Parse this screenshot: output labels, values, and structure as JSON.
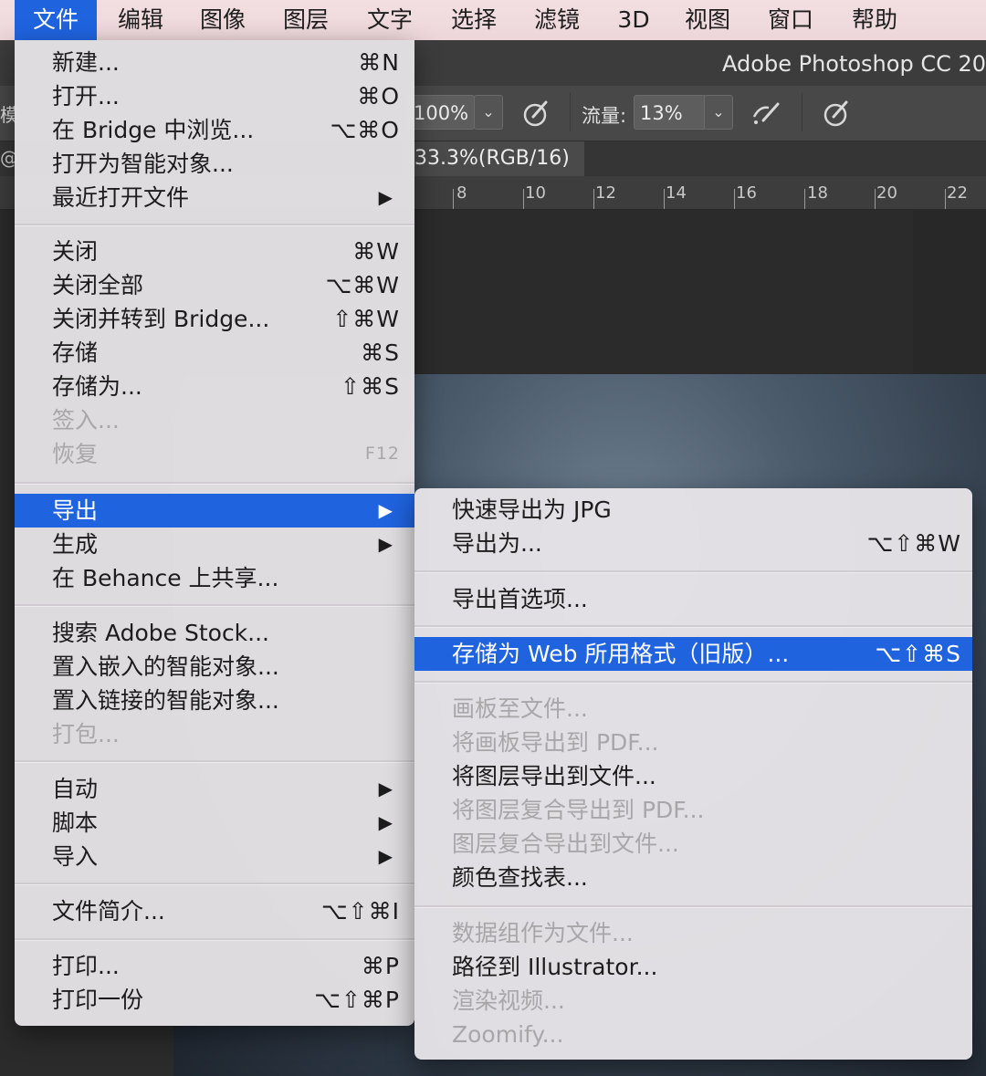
{
  "menubar": {
    "items": [
      "文件",
      "编辑",
      "图像",
      "图层",
      "文字",
      "选择",
      "滤镜",
      "3D",
      "视图",
      "窗口",
      "帮助"
    ],
    "active_index": 0
  },
  "ps": {
    "title": "Adobe Photoshop CC 20",
    "zoom_fragment": "100%",
    "flow_label": "流量:",
    "flow_value": "13%",
    "doc_tab": "33.3%(RGB/16)",
    "left_edge_char": "模",
    "left_edge_at": "@",
    "ruler_numbers": [
      "8",
      "10",
      "12",
      "14",
      "16",
      "18",
      "20",
      "22"
    ]
  },
  "file_menu": {
    "groups": [
      [
        {
          "label": "新建...",
          "shortcut": "⌘N"
        },
        {
          "label": "打开...",
          "shortcut": "⌘O"
        },
        {
          "label": "在 Bridge 中浏览...",
          "shortcut": "⌥⌘O"
        },
        {
          "label": "打开为智能对象...",
          "shortcut": ""
        },
        {
          "label": "最近打开文件",
          "submenu": true
        }
      ],
      [
        {
          "label": "关闭",
          "shortcut": "⌘W"
        },
        {
          "label": "关闭全部",
          "shortcut": "⌥⌘W"
        },
        {
          "label": "关闭并转到 Bridge...",
          "shortcut": "⇧⌘W"
        },
        {
          "label": "存储",
          "shortcut": "⌘S"
        },
        {
          "label": "存储为...",
          "shortcut": "⇧⌘S"
        },
        {
          "label": "签入...",
          "disabled": true
        },
        {
          "label": "恢复",
          "shortcut": "F12",
          "disabled": true
        }
      ],
      [
        {
          "label": "导出",
          "submenu": true,
          "highlight": true
        },
        {
          "label": "生成",
          "submenu": true
        },
        {
          "label": "在 Behance 上共享..."
        }
      ],
      [
        {
          "label": "搜索 Adobe Stock..."
        },
        {
          "label": "置入嵌入的智能对象..."
        },
        {
          "label": "置入链接的智能对象..."
        },
        {
          "label": "打包...",
          "disabled": true
        }
      ],
      [
        {
          "label": "自动",
          "submenu": true
        },
        {
          "label": "脚本",
          "submenu": true
        },
        {
          "label": "导入",
          "submenu": true
        }
      ],
      [
        {
          "label": "文件简介...",
          "shortcut": "⌥⇧⌘I"
        }
      ],
      [
        {
          "label": "打印...",
          "shortcut": "⌘P"
        },
        {
          "label": "打印一份",
          "shortcut": "⌥⇧⌘P"
        }
      ]
    ]
  },
  "export_menu": {
    "groups": [
      [
        {
          "label": "快速导出为 JPG"
        },
        {
          "label": "导出为...",
          "shortcut": "⌥⇧⌘W"
        }
      ],
      [
        {
          "label": "导出首选项..."
        }
      ],
      [
        {
          "label": "存储为 Web 所用格式（旧版）...",
          "shortcut": "⌥⇧⌘S",
          "highlight": true
        }
      ],
      [
        {
          "label": "画板至文件...",
          "disabled": true
        },
        {
          "label": "将画板导出到 PDF...",
          "disabled": true
        },
        {
          "label": "将图层导出到文件..."
        },
        {
          "label": "将图层复合导出到 PDF...",
          "disabled": true
        },
        {
          "label": "图层复合导出到文件...",
          "disabled": true
        },
        {
          "label": "颜色查找表..."
        }
      ],
      [
        {
          "label": "数据组作为文件...",
          "disabled": true
        },
        {
          "label": "路径到 Illustrator..."
        },
        {
          "label": "渲染视频...",
          "disabled": true
        },
        {
          "label": "Zoomify...",
          "disabled": true
        }
      ]
    ]
  },
  "icons": {
    "submenu_arrow": "▶",
    "dropdown": "⌄",
    "airbrush_icon": "brush-pressure-icon",
    "smoothing_icon": "airbrush-icon",
    "pressure_icon": "pressure-size-icon"
  },
  "colors": {
    "highlight": "#1f63df",
    "menu_bg": "#e4e1e4",
    "disabled_text": "#a9a6aa",
    "menubar_bg": "#f3dfe2"
  }
}
